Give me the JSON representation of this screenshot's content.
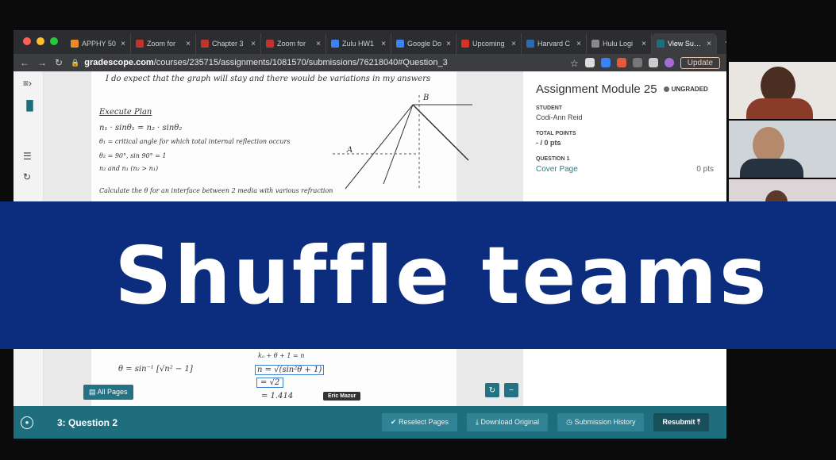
{
  "browser": {
    "tabs": [
      {
        "label": "APPHY 50",
        "color": "#f08a24"
      },
      {
        "label": "Zoom for",
        "color": "#c0352b"
      },
      {
        "label": "Chapter 3",
        "color": "#c0352b"
      },
      {
        "label": "Zoom for",
        "color": "#c0352b"
      },
      {
        "label": "Zulu HW1",
        "color": "#3b82f6"
      },
      {
        "label": "Google Do",
        "color": "#3b82f6"
      },
      {
        "label": "Upcoming",
        "color": "#d93025"
      },
      {
        "label": "Harvard C",
        "color": "#2b6cb0"
      },
      {
        "label": "Hulu Logi",
        "color": "#888888"
      },
      {
        "label": "View Subm",
        "color": "#1e6e7e"
      }
    ],
    "url_host": "gradescope.com",
    "url_path": "/courses/235715/assignments/1081570/submissions/76218040#Question_3",
    "update_label": "Update"
  },
  "sidebar": {
    "title": "Assignment Module 25",
    "status": "UNGRADED",
    "student_label": "STUDENT",
    "student": "Codi-Ann Reid",
    "points_label": "TOTAL POINTS",
    "points": "- / 0 pts",
    "question_label": "QUESTION 1",
    "question_name": "Cover Page",
    "question_pts": "0 pts"
  },
  "handwriting": {
    "line1": "I do expect that the graph will stay and there would be variations in my answers",
    "heading": "Execute Plan",
    "eq1": "n₁ · sinθ₁ = n₂ · sinθ₂",
    "eq2": "θ₁ = critical angle for which total internal reflection occurs",
    "eq3": "θ₂ = 90°, sin 90° = 1",
    "eq4": "n₂ and n₁ (n₂ > n₁)",
    "eq5": "Calculate the θ for an interface between 2 media with various refraction",
    "eq6": "θ = sin⁻¹ [√n² − 1]",
    "eq7": "n = √(sin²θ + 1)",
    "eq8": "= √2",
    "eq9": "= 1.414",
    "eq10": "kₒ + θ + 1 = n",
    "diag_b": "B",
    "diag_a": "A"
  },
  "viewer": {
    "all_pages": "All Pages",
    "commenter": "Eric Mazur"
  },
  "footer": {
    "question": "3: Question 2",
    "reselect": "Reselect Pages",
    "download": "Download Original",
    "history": "Submission History",
    "resubmit": "Resubmit"
  },
  "banner": {
    "text": "Shuffle teams"
  }
}
